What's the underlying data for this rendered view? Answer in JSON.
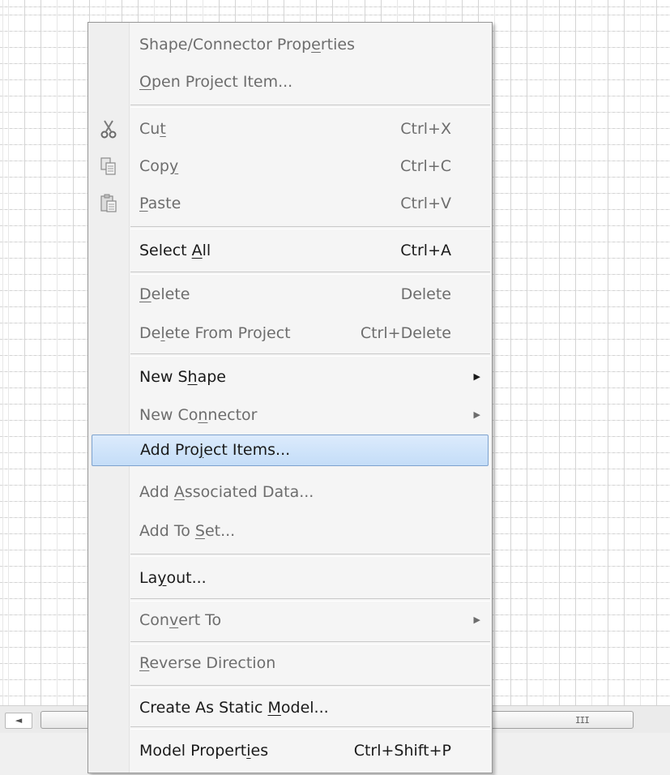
{
  "menu": {
    "items": [
      {
        "id": "shape-connector-properties",
        "before": "Shape/Connector Prop",
        "mn": "e",
        "after": "rties",
        "shortcut": "",
        "enabled": false
      },
      {
        "id": "open-project-item",
        "before": "",
        "mn": "O",
        "after": "pen Project Item...",
        "shortcut": "",
        "enabled": false
      },
      {
        "id": "cut",
        "before": "Cu",
        "mn": "t",
        "after": "",
        "shortcut": "Ctrl+X",
        "enabled": false,
        "icon": "scissors-icon"
      },
      {
        "id": "copy",
        "before": "Cop",
        "mn": "y",
        "after": "",
        "shortcut": "Ctrl+C",
        "enabled": false,
        "icon": "copy-icon"
      },
      {
        "id": "paste",
        "before": "",
        "mn": "P",
        "after": "aste",
        "shortcut": "Ctrl+V",
        "enabled": false,
        "icon": "paste-icon"
      },
      {
        "id": "select-all",
        "before": "Select ",
        "mn": "A",
        "after": "ll",
        "shortcut": "Ctrl+A",
        "enabled": true
      },
      {
        "id": "delete",
        "before": "",
        "mn": "D",
        "after": "elete",
        "shortcut": "Delete",
        "enabled": false
      },
      {
        "id": "delete-from-project",
        "before": "De",
        "mn": "l",
        "after": "ete From Project",
        "shortcut": "Ctrl+Delete",
        "enabled": false
      },
      {
        "id": "new-shape",
        "before": "New S",
        "mn": "h",
        "after": "ape",
        "shortcut": "",
        "enabled": true,
        "submenu": true
      },
      {
        "id": "new-connector",
        "before": "New Co",
        "mn": "n",
        "after": "nector",
        "shortcut": "",
        "enabled": false,
        "submenu": true
      },
      {
        "id": "add-project-items",
        "before": "Add Pro",
        "mn": "j",
        "after": "ect Items...",
        "shortcut": "",
        "enabled": true,
        "highlighted": true
      },
      {
        "id": "add-associated-data",
        "before": "Add ",
        "mn": "A",
        "after": "ssociated Data...",
        "shortcut": "",
        "enabled": false
      },
      {
        "id": "add-to-set",
        "before": "Add To ",
        "mn": "S",
        "after": "et...",
        "shortcut": "",
        "enabled": false
      },
      {
        "id": "layout",
        "before": "La",
        "mn": "y",
        "after": "out...",
        "shortcut": "",
        "enabled": true
      },
      {
        "id": "convert-to",
        "before": "Con",
        "mn": "v",
        "after": "ert To",
        "shortcut": "",
        "enabled": false,
        "submenu": true
      },
      {
        "id": "reverse-direction",
        "before": "",
        "mn": "R",
        "after": "everse Direction",
        "shortcut": "",
        "enabled": false
      },
      {
        "id": "create-as-static-model",
        "before": "Create As Static ",
        "mn": "M",
        "after": "odel...",
        "shortcut": "",
        "enabled": true
      },
      {
        "id": "model-properties",
        "before": "Model Propert",
        "mn": "i",
        "after": "es",
        "shortcut": "Ctrl+Shift+P",
        "enabled": true
      }
    ]
  },
  "scrollbar": {
    "left_arrow": "◄",
    "grip": "III"
  },
  "colors": {
    "highlight_border": "#7da2ce",
    "highlight_fill": "#c4ddf8",
    "disabled_text": "#6d6d6d"
  }
}
